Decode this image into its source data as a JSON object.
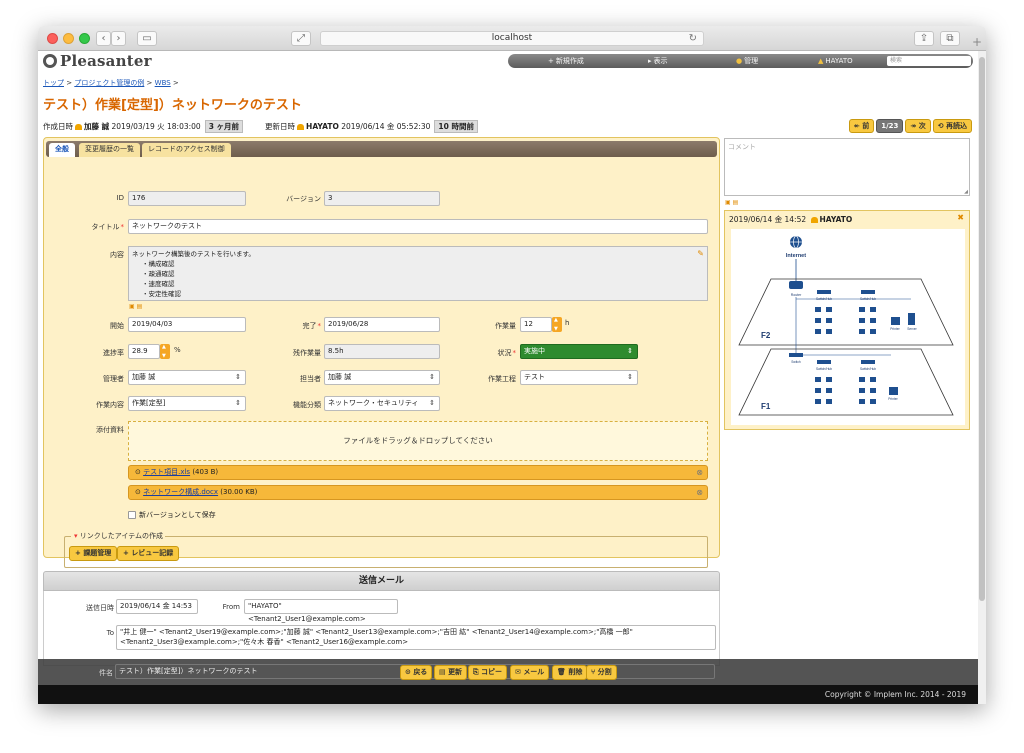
{
  "browser": {
    "url": "localhost"
  },
  "app": {
    "logo": "Pleasanter"
  },
  "nav": {
    "items": [
      {
        "label": "新規作成",
        "icon": "plus-icon"
      },
      {
        "label": "表示",
        "icon": "triangle-icon"
      },
      {
        "label": "管理",
        "icon": "gear-icon"
      },
      {
        "label": "HAYATO",
        "icon": "user-icon"
      }
    ],
    "search_placeholder": "検索"
  },
  "breadcrumb": [
    "トップ",
    "プロジェクト管理の例",
    "WBS"
  ],
  "page_title": "テスト）作業[定型]）ネットワークのテスト",
  "meta": {
    "created_label": "作成日時",
    "created_by": "加藤 誠",
    "created_at": "2019/03/19 火 18:03:00",
    "created_ago": "3 ヶ月前",
    "updated_label": "更新日時",
    "updated_by": "HAYATO",
    "updated_at": "2019/06/14 金 05:52:30",
    "updated_ago": "10 時間前"
  },
  "pager": {
    "prev": "前",
    "position": "1/23",
    "next": "次",
    "reload": "再読込"
  },
  "tabs": [
    "全般",
    "変更履歴の一覧",
    "レコードのアクセス制御"
  ],
  "form": {
    "id_label": "ID",
    "id": "176",
    "version_label": "バージョン",
    "version": "3",
    "title_label": "タイトル",
    "title": "ネットワークのテスト",
    "body_label": "内容",
    "body_lines": [
      "ネットワーク構築後のテストを行います。",
      "・構成確認",
      "・疎通確認",
      "・速度確認",
      "・安定性確認"
    ],
    "start_label": "開始",
    "start": "2019/04/03",
    "end_label": "完了",
    "end": "2019/06/28",
    "work_label": "作業量",
    "work": "12",
    "work_unit": "h",
    "progress_label": "進捗率",
    "progress": "28.9",
    "progress_unit": "%",
    "remaining_label": "残作業量",
    "remaining": "8.5h",
    "status_label": "状況",
    "status": "実施中",
    "manager_label": "管理者",
    "manager": "加藤 誠",
    "owner_label": "担当者",
    "owner": "加藤 誠",
    "process_label": "作業工程",
    "process": "テスト",
    "content_label": "作業内容",
    "content": "作業[定型]",
    "category_label": "機能分類",
    "category": "ネットワーク・セキュリティ",
    "attach_label": "添付資料",
    "drop_text": "ファイルをドラッグ＆ドロップしてください",
    "files": [
      {
        "name": "テスト項目.xls",
        "size": "(403 B)"
      },
      {
        "name": "ネットワーク構成.docx",
        "size": "(30.00 KB)"
      }
    ],
    "new_version_label": "新バージョンとして保存",
    "linked_legend": "リンクしたアイテムの作成",
    "linked_buttons": [
      "課題管理",
      "レビュー記録"
    ]
  },
  "mail": {
    "header": "送信メール",
    "sent_label": "送信日時",
    "sent_at": "2019/06/14 金 14:53",
    "from_label": "From",
    "from": "\"HAYATO\" <Tenant2_User1@example.com>",
    "to_label": "To",
    "to_line1": "\"井上 健一\" <Tenant2_User19@example.com>;\"加藤 誠\" <Tenant2_User13@example.com>;\"吉田 紘\" <Tenant2_User14@example.com>;\"高橋 一郎\"",
    "to_line2": "<Tenant2_User3@example.com>;\"佐々木 春香\" <Tenant2_User16@example.com>",
    "subject_label": "件名",
    "subject": "テスト）作業[定型]）ネットワークのテスト"
  },
  "actions": [
    "戻る",
    "更新",
    "コピー",
    "メール",
    "削除",
    "分割"
  ],
  "footer": "Copyright © Implem Inc. 2014 - 2019",
  "comment": {
    "placeholder": "コメント",
    "date": "2019/06/14 金 14:52",
    "author": "HAYATO"
  },
  "diagram": {
    "internet": "Internet",
    "router": "Router",
    "switch_hub": "Switch/Hub",
    "switch": "Switch",
    "printer": "Printer",
    "server": "Server",
    "floor2": "F2",
    "floor1": "F1"
  }
}
